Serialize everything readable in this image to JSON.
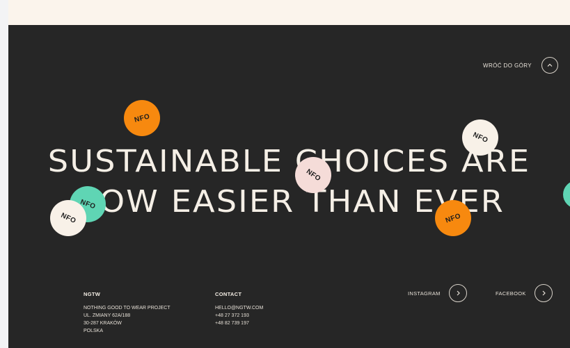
{
  "back_to_top": {
    "label": "WRÓĆ DO GÓRY",
    "icon": "chevron-up-icon"
  },
  "hero": {
    "line1": "SUSTAINABLE CHOICES ARE",
    "line2": "NOW EASIER THAN EVER"
  },
  "stickers": [
    {
      "text": "NFO",
      "color": "#f7890f"
    },
    {
      "text": "NFO",
      "color": "#f8f1e8"
    },
    {
      "text": "NFO",
      "color": "#f5dcd8"
    },
    {
      "text": "NFO",
      "color": "#5fd5b4"
    },
    {
      "text": "NFO",
      "color": "#f8f1e8"
    },
    {
      "text": "NFO",
      "color": "#f7890f"
    }
  ],
  "footer": {
    "company": {
      "title": "NGTW",
      "lines": [
        "NOTHING GOOD TO WEAR PROJECT",
        "UL. ZMIANY 62A/188",
        "30-287 KRAKÓW",
        "POLSKA"
      ]
    },
    "contact": {
      "title": "CONTACT",
      "lines": [
        "HELLO@NGTW.COM",
        "+48 27 372 193",
        "+48 82 739 197"
      ]
    },
    "social": [
      {
        "label": "INSTAGRAM",
        "icon": "chevron-right-icon"
      },
      {
        "label": "FACEBOOK",
        "icon": "chevron-right-icon"
      }
    ]
  },
  "colors": {
    "background": "#262626",
    "text": "#f5efe6",
    "top_band": "#fbf4ec",
    "orange": "#f7890f",
    "mint": "#5fd5b4",
    "pink": "#f5dcd8",
    "cream": "#f8f1e8"
  }
}
